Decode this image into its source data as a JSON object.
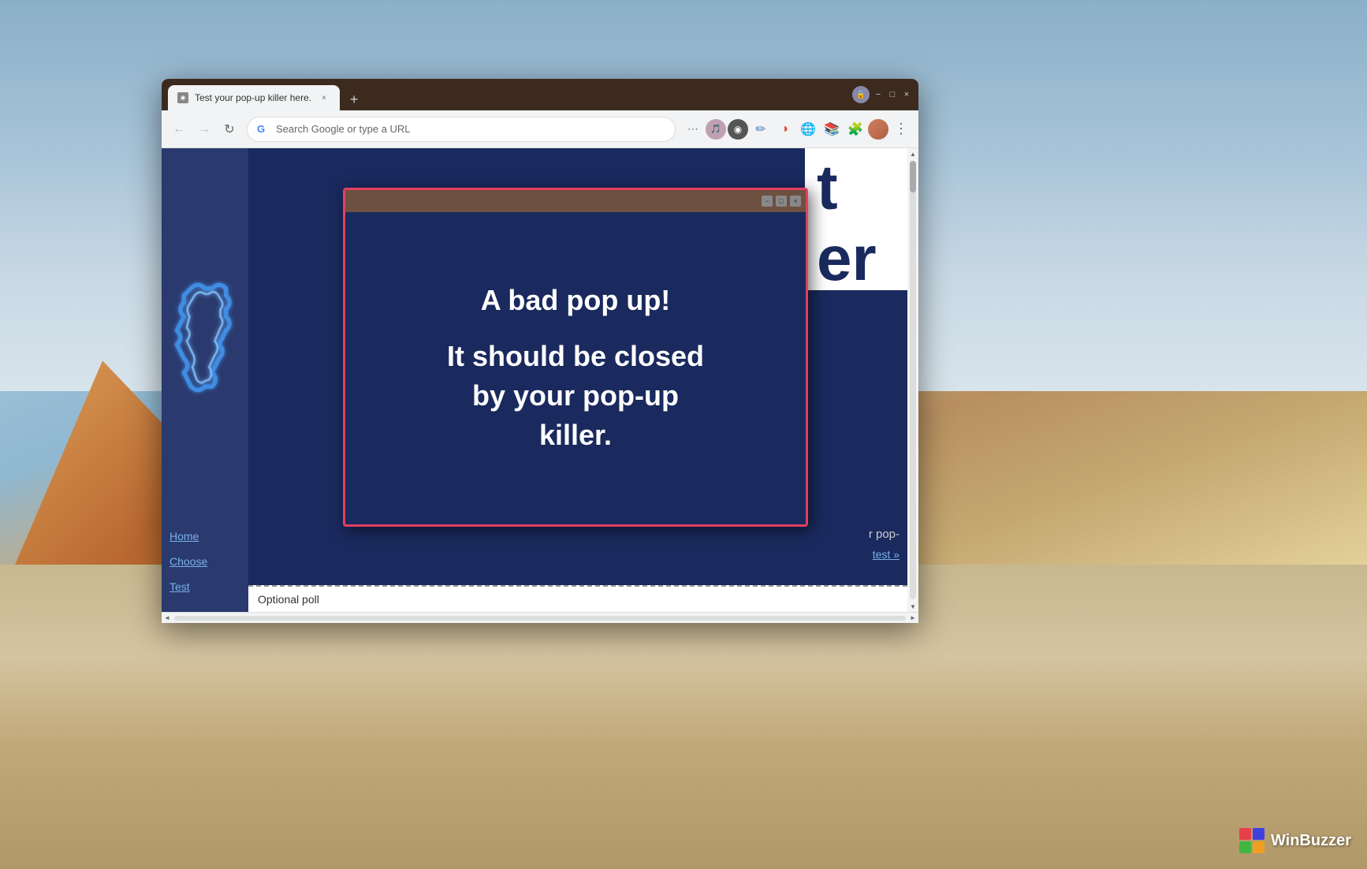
{
  "desktop": {
    "background_desc": "Desert landscape with sky and sand dunes"
  },
  "winbuzzer": {
    "text": "WinBuzzer"
  },
  "browser": {
    "title_bar": {
      "tab_title": "Test your pop-up killer here.",
      "new_tab_label": "+",
      "controls": {
        "minimize": "−",
        "maximize": "□",
        "close": "×"
      }
    },
    "toolbar": {
      "back_label": "←",
      "forward_label": "→",
      "reload_label": "↻",
      "address_placeholder": "Search Google or type a URL",
      "address_value": "Search Google or type a URL"
    },
    "sidebar": {
      "nav_items": [
        {
          "label": "Home",
          "href": "#"
        },
        {
          "label": "Choose",
          "href": "#"
        },
        {
          "label": "Test",
          "href": "#"
        }
      ]
    },
    "page": {
      "title_partial_1": "t",
      "title_partial_2": "er",
      "body_text_1": "r pop-",
      "poll_label": "Optional poll",
      "link_text": "test »"
    }
  },
  "popup": {
    "title": "",
    "controls": {
      "minimize": "−",
      "maximize": "□",
      "close": "×"
    },
    "line1": "A bad pop up!",
    "line2": "It should be closed",
    "line3": "by your pop-up",
    "line4": "killer."
  }
}
